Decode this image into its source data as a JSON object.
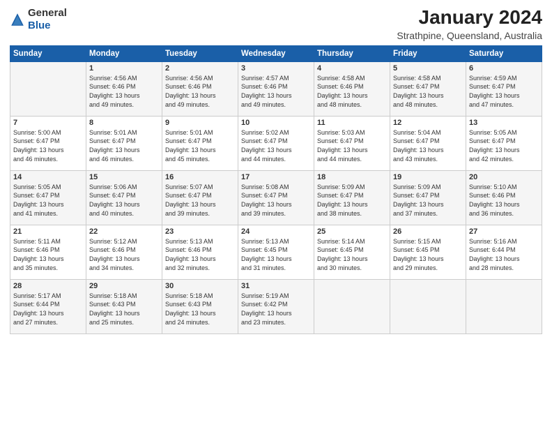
{
  "logo": {
    "general": "General",
    "blue": "Blue"
  },
  "title": "January 2024",
  "subtitle": "Strathpine, Queensland, Australia",
  "days_of_week": [
    "Sunday",
    "Monday",
    "Tuesday",
    "Wednesday",
    "Thursday",
    "Friday",
    "Saturday"
  ],
  "weeks": [
    [
      {
        "day": "",
        "info": ""
      },
      {
        "day": "1",
        "info": "Sunrise: 4:56 AM\nSunset: 6:46 PM\nDaylight: 13 hours\nand 49 minutes."
      },
      {
        "day": "2",
        "info": "Sunrise: 4:56 AM\nSunset: 6:46 PM\nDaylight: 13 hours\nand 49 minutes."
      },
      {
        "day": "3",
        "info": "Sunrise: 4:57 AM\nSunset: 6:46 PM\nDaylight: 13 hours\nand 49 minutes."
      },
      {
        "day": "4",
        "info": "Sunrise: 4:58 AM\nSunset: 6:46 PM\nDaylight: 13 hours\nand 48 minutes."
      },
      {
        "day": "5",
        "info": "Sunrise: 4:58 AM\nSunset: 6:47 PM\nDaylight: 13 hours\nand 48 minutes."
      },
      {
        "day": "6",
        "info": "Sunrise: 4:59 AM\nSunset: 6:47 PM\nDaylight: 13 hours\nand 47 minutes."
      }
    ],
    [
      {
        "day": "7",
        "info": "Sunrise: 5:00 AM\nSunset: 6:47 PM\nDaylight: 13 hours\nand 46 minutes."
      },
      {
        "day": "8",
        "info": "Sunrise: 5:01 AM\nSunset: 6:47 PM\nDaylight: 13 hours\nand 46 minutes."
      },
      {
        "day": "9",
        "info": "Sunrise: 5:01 AM\nSunset: 6:47 PM\nDaylight: 13 hours\nand 45 minutes."
      },
      {
        "day": "10",
        "info": "Sunrise: 5:02 AM\nSunset: 6:47 PM\nDaylight: 13 hours\nand 44 minutes."
      },
      {
        "day": "11",
        "info": "Sunrise: 5:03 AM\nSunset: 6:47 PM\nDaylight: 13 hours\nand 44 minutes."
      },
      {
        "day": "12",
        "info": "Sunrise: 5:04 AM\nSunset: 6:47 PM\nDaylight: 13 hours\nand 43 minutes."
      },
      {
        "day": "13",
        "info": "Sunrise: 5:05 AM\nSunset: 6:47 PM\nDaylight: 13 hours\nand 42 minutes."
      }
    ],
    [
      {
        "day": "14",
        "info": "Sunrise: 5:05 AM\nSunset: 6:47 PM\nDaylight: 13 hours\nand 41 minutes."
      },
      {
        "day": "15",
        "info": "Sunrise: 5:06 AM\nSunset: 6:47 PM\nDaylight: 13 hours\nand 40 minutes."
      },
      {
        "day": "16",
        "info": "Sunrise: 5:07 AM\nSunset: 6:47 PM\nDaylight: 13 hours\nand 39 minutes."
      },
      {
        "day": "17",
        "info": "Sunrise: 5:08 AM\nSunset: 6:47 PM\nDaylight: 13 hours\nand 39 minutes."
      },
      {
        "day": "18",
        "info": "Sunrise: 5:09 AM\nSunset: 6:47 PM\nDaylight: 13 hours\nand 38 minutes."
      },
      {
        "day": "19",
        "info": "Sunrise: 5:09 AM\nSunset: 6:47 PM\nDaylight: 13 hours\nand 37 minutes."
      },
      {
        "day": "20",
        "info": "Sunrise: 5:10 AM\nSunset: 6:46 PM\nDaylight: 13 hours\nand 36 minutes."
      }
    ],
    [
      {
        "day": "21",
        "info": "Sunrise: 5:11 AM\nSunset: 6:46 PM\nDaylight: 13 hours\nand 35 minutes."
      },
      {
        "day": "22",
        "info": "Sunrise: 5:12 AM\nSunset: 6:46 PM\nDaylight: 13 hours\nand 34 minutes."
      },
      {
        "day": "23",
        "info": "Sunrise: 5:13 AM\nSunset: 6:46 PM\nDaylight: 13 hours\nand 32 minutes."
      },
      {
        "day": "24",
        "info": "Sunrise: 5:13 AM\nSunset: 6:45 PM\nDaylight: 13 hours\nand 31 minutes."
      },
      {
        "day": "25",
        "info": "Sunrise: 5:14 AM\nSunset: 6:45 PM\nDaylight: 13 hours\nand 30 minutes."
      },
      {
        "day": "26",
        "info": "Sunrise: 5:15 AM\nSunset: 6:45 PM\nDaylight: 13 hours\nand 29 minutes."
      },
      {
        "day": "27",
        "info": "Sunrise: 5:16 AM\nSunset: 6:44 PM\nDaylight: 13 hours\nand 28 minutes."
      }
    ],
    [
      {
        "day": "28",
        "info": "Sunrise: 5:17 AM\nSunset: 6:44 PM\nDaylight: 13 hours\nand 27 minutes."
      },
      {
        "day": "29",
        "info": "Sunrise: 5:18 AM\nSunset: 6:43 PM\nDaylight: 13 hours\nand 25 minutes."
      },
      {
        "day": "30",
        "info": "Sunrise: 5:18 AM\nSunset: 6:43 PM\nDaylight: 13 hours\nand 24 minutes."
      },
      {
        "day": "31",
        "info": "Sunrise: 5:19 AM\nSunset: 6:42 PM\nDaylight: 13 hours\nand 23 minutes."
      },
      {
        "day": "",
        "info": ""
      },
      {
        "day": "",
        "info": ""
      },
      {
        "day": "",
        "info": ""
      }
    ]
  ]
}
